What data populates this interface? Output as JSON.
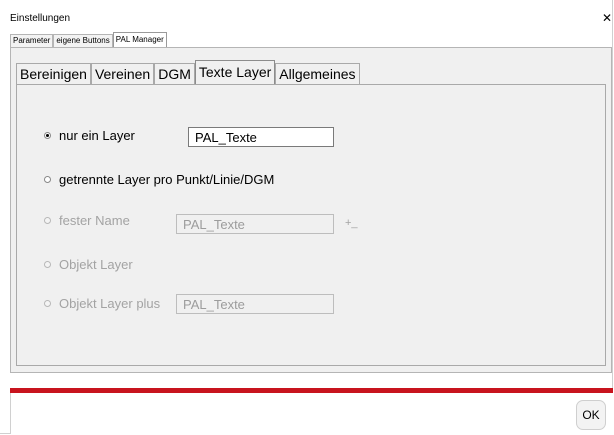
{
  "window": {
    "title": "Einstellungen",
    "close_glyph": "✕"
  },
  "outer_tabs": [
    {
      "label": "Parameter"
    },
    {
      "label": "eigene Buttons"
    },
    {
      "label": "PAL Manager",
      "active": true
    }
  ],
  "inner_tabs": [
    {
      "label": "Bereinigen"
    },
    {
      "label": "Vereinen"
    },
    {
      "label": "DGM"
    },
    {
      "label": "Texte Layer",
      "active": true
    },
    {
      "label": "Allgemeines"
    }
  ],
  "options": {
    "nur_ein_layer": {
      "label": "nur ein Layer",
      "checked": true,
      "enabled": true,
      "value": "PAL_Texte"
    },
    "getrennte_layer": {
      "label": "getrennte Layer pro Punkt/Linie/DGM",
      "checked": false,
      "enabled": true
    },
    "fester_name": {
      "label": "fester Name",
      "checked": false,
      "enabled": false,
      "value": "PAL_Texte",
      "suffix": "+_"
    },
    "objekt_layer": {
      "label": "Objekt Layer",
      "checked": false,
      "enabled": false
    },
    "objekt_layer_plus": {
      "label": "Objekt Layer plus",
      "checked": false,
      "enabled": false,
      "value": "PAL_Texte"
    }
  },
  "footer": {
    "ok_label": "OK"
  },
  "colors": {
    "accent_line": "#c8141e",
    "panel_bg": "#f0f0f0",
    "disabled_text": "#a3a3a3"
  }
}
